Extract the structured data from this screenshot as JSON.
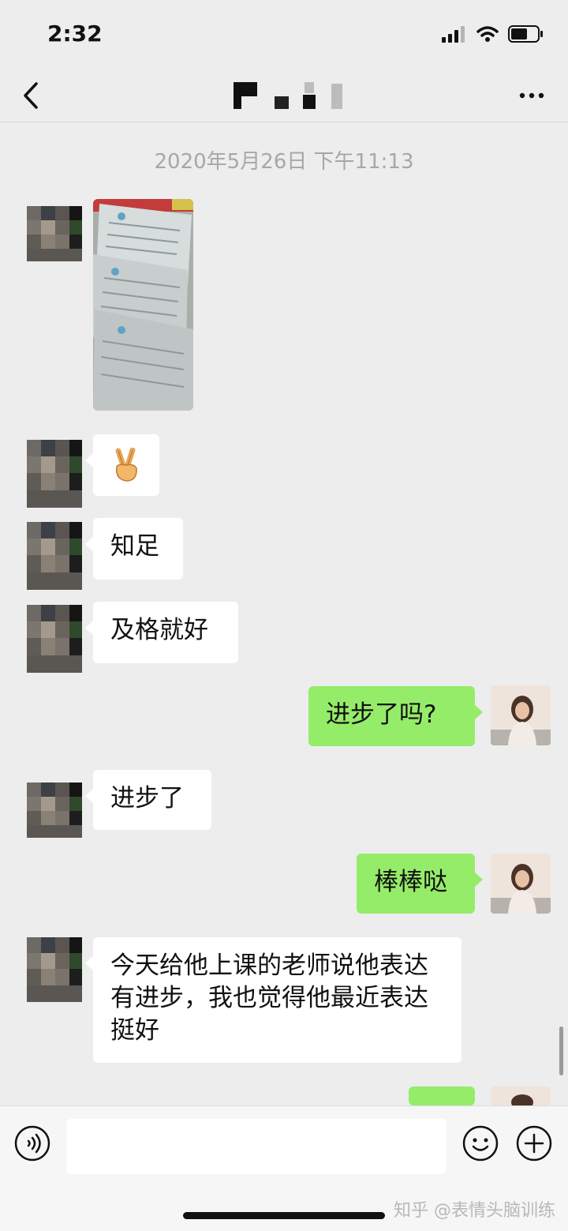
{
  "status_bar": {
    "time": "2:32"
  },
  "chat": {
    "title_hidden": true,
    "timestamp": "2020年5月26日 下午11:13",
    "messages": [
      {
        "side": "left",
        "type": "image"
      },
      {
        "side": "left",
        "type": "emoji",
        "text": "✌️"
      },
      {
        "side": "left",
        "type": "text",
        "text": "知足"
      },
      {
        "side": "left",
        "type": "text",
        "text": "及格就好"
      },
      {
        "side": "right",
        "type": "text",
        "text": "进步了吗?"
      },
      {
        "side": "left",
        "type": "text",
        "text": "进步了"
      },
      {
        "side": "right",
        "type": "text",
        "text": "棒棒哒"
      },
      {
        "side": "left",
        "type": "text",
        "text": "今天给他上课的老师说他表达有进步，我也觉得他最近表达挺好"
      },
      {
        "side": "right",
        "type": "emoji",
        "text": ""
      }
    ]
  },
  "input_bar": {
    "placeholder": ""
  },
  "watermark": "知乎 @表情头脑训练",
  "colors": {
    "background": "#ededed",
    "sent_bubble": "#95ec69",
    "received_bubble": "#ffffff",
    "timestamp": "#a7a7a7"
  },
  "icons": [
    "back-icon",
    "more-icon",
    "signal-icon",
    "wifi-icon",
    "battery-icon",
    "voice-icon",
    "emoji-icon",
    "plus-icon"
  ]
}
